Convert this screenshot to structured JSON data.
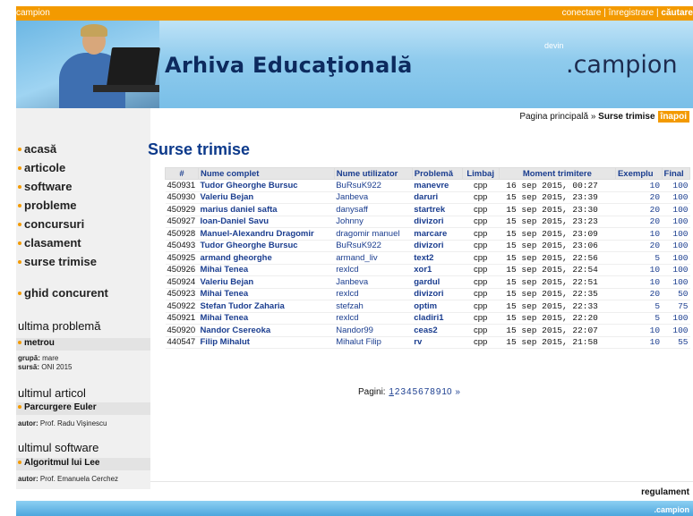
{
  "topbar": {
    "brand": "campion",
    "login": "conectare",
    "register": "înregistrare",
    "search": "căutare",
    "separator": " | "
  },
  "header": {
    "site_title": "Arhiva Educaţională",
    "logo_small": "devin",
    "logo": ".campi",
    "logo_on": "on"
  },
  "breadcrumb": {
    "home": "Pagina principală",
    "separator": " » ",
    "current": "Surse trimise",
    "back": "înapoi"
  },
  "sidebar": {
    "nav": [
      "acasă",
      "articole",
      "software",
      "probleme",
      "concursuri",
      "clasament",
      "surse trimise"
    ],
    "nav_extra": "ghid concurent",
    "last_problem": {
      "title": "ultima problemă",
      "item": "metrou",
      "group_label": "grupă:",
      "group": "mare",
      "source_label": "sursă:",
      "source": "ONI 2015"
    },
    "last_article": {
      "title": "ultimul articol",
      "item": "Parcurgere Euler",
      "author_label": "autor:",
      "author": "Prof. Radu Vişinescu"
    },
    "last_software": {
      "title": "ultimul software",
      "item": "Algoritmul lui Lee",
      "author_label": "autor:",
      "author": "Prof. Emanuela Cerchez"
    }
  },
  "main": {
    "title": "Surse trimise",
    "columns": [
      "#",
      "Nume complet",
      "Nume utilizator",
      "Problemă",
      "Limbaj",
      "Moment trimitere",
      "Exemplu",
      "Final"
    ],
    "rows": [
      {
        "id": "450931",
        "name": "Tudor Gheorghe Bursuc",
        "user": "BuRsuK922",
        "problem": "manevre",
        "lang": "cpp",
        "time": "16 sep 2015, 00:27",
        "example": "10",
        "final": "100"
      },
      {
        "id": "450930",
        "name": "Valeriu Bejan",
        "user": "Janbeva",
        "problem": "daruri",
        "lang": "cpp",
        "time": "15 sep 2015, 23:39",
        "example": "20",
        "final": "100"
      },
      {
        "id": "450929",
        "name": "marius daniel safta",
        "user": "danysaff",
        "problem": "startrek",
        "lang": "cpp",
        "time": "15 sep 2015, 23:30",
        "example": "20",
        "final": "100"
      },
      {
        "id": "450927",
        "name": "Ioan-Daniel Savu",
        "user": "Johnny",
        "problem": "divizori",
        "lang": "cpp",
        "time": "15 sep 2015, 23:23",
        "example": "20",
        "final": "100"
      },
      {
        "id": "450928",
        "name": "Manuel-Alexandru Dragomir",
        "user": "dragomir manuel",
        "problem": "marcare",
        "lang": "cpp",
        "time": "15 sep 2015, 23:09",
        "example": "10",
        "final": "100"
      },
      {
        "id": "450493",
        "name": "Tudor Gheorghe Bursuc",
        "user": "BuRsuK922",
        "problem": "divizori",
        "lang": "cpp",
        "time": "15 sep 2015, 23:06",
        "example": "20",
        "final": "100"
      },
      {
        "id": "450925",
        "name": "armand gheorghe",
        "user": "armand_liv",
        "problem": "text2",
        "lang": "cpp",
        "time": "15 sep 2015, 22:56",
        "example": "5",
        "final": "100"
      },
      {
        "id": "450926",
        "name": "Mihai Tenea",
        "user": "rexlcd",
        "problem": "xor1",
        "lang": "cpp",
        "time": "15 sep 2015, 22:54",
        "example": "10",
        "final": "100"
      },
      {
        "id": "450924",
        "name": "Valeriu Bejan",
        "user": "Janbeva",
        "problem": "gardul",
        "lang": "cpp",
        "time": "15 sep 2015, 22:51",
        "example": "10",
        "final": "100"
      },
      {
        "id": "450923",
        "name": "Mihai Tenea",
        "user": "rexlcd",
        "problem": "divizori",
        "lang": "cpp",
        "time": "15 sep 2015, 22:35",
        "example": "20",
        "final": "50"
      },
      {
        "id": "450922",
        "name": "Stefan Tudor Zaharia",
        "user": "stefzah",
        "problem": "optim",
        "lang": "cpp",
        "time": "15 sep 2015, 22:33",
        "example": "5",
        "final": "75"
      },
      {
        "id": "450921",
        "name": "Mihai Tenea",
        "user": "rexlcd",
        "problem": "cladiri1",
        "lang": "cpp",
        "time": "15 sep 2015, 22:20",
        "example": "5",
        "final": "100"
      },
      {
        "id": "450920",
        "name": "Nandor Csereoka",
        "user": "Nandor99",
        "problem": "ceas2",
        "lang": "cpp",
        "time": "15 sep 2015, 22:07",
        "example": "10",
        "final": "100"
      },
      {
        "id": "440547",
        "name": "Filip Mihalut",
        "user": "Mihalut Filip",
        "problem": "rv",
        "lang": "cpp",
        "time": "15 sep 2015, 21:58",
        "example": "10",
        "final": "55"
      }
    ],
    "pagination": {
      "label": "Pagini:",
      "pages": [
        "1",
        "2",
        "3",
        "4",
        "5",
        "6",
        "7",
        "8",
        "9",
        "10"
      ],
      "next": "»"
    }
  },
  "footer": {
    "regulament": "regulament",
    "brand": ".campion"
  },
  "colors": {
    "accent": "#f39a00",
    "link": "#1a3d8f",
    "title": "#0d3a8b"
  }
}
